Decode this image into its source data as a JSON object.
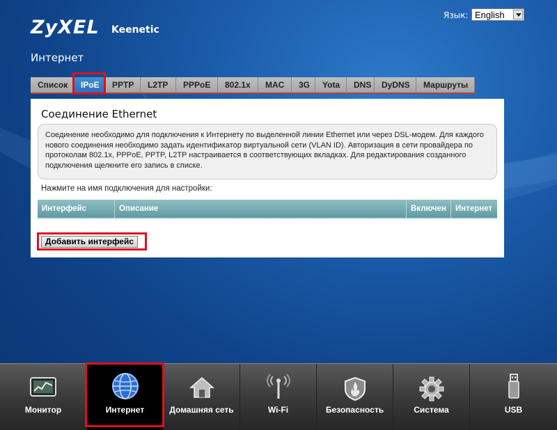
{
  "header": {
    "logo": "ZyXEL",
    "model": "Keenetic",
    "page_title": "Интернет",
    "language_label": "Язык:",
    "language_value": "English"
  },
  "tabs": [
    {
      "label": "Список",
      "active": false
    },
    {
      "label": "IPoE",
      "active": true
    },
    {
      "label": "PPTP",
      "active": false
    },
    {
      "label": "L2TP",
      "active": false
    },
    {
      "label": "PPPoE",
      "active": false
    },
    {
      "label": "802.1x",
      "active": false
    },
    {
      "label": "MAC",
      "active": false
    },
    {
      "label": "3G",
      "active": false
    },
    {
      "label": "Yota",
      "active": false
    },
    {
      "label": "DNS",
      "active": false
    },
    {
      "label": "DyDNS",
      "active": false
    },
    {
      "label": "Маршруты",
      "active": false
    }
  ],
  "panel": {
    "title": "Соединение Ethernet",
    "info_text": "Соединение необходимо для подключения к Интернету по выделенной линии Ethernet или через DSL-модем. Для каждого нового соединения необходимо задать идентификатор виртуальной сети (VLAN ID). Авторизация в сети провайдера по протоколам 802.1x, PPPoE, PPTP, L2TP настраивается в соответствующих вкладках. Для редактирования созданного подключения щелкните его запись в списке.",
    "hint": "Нажмите на имя подключения для настройки:",
    "table_headers": [
      "Интерфейс",
      "Описание",
      "Включен",
      "Интернет"
    ],
    "add_button": "Добавить интерфейс"
  },
  "bottom_nav": [
    {
      "label": "Монитор",
      "icon": "monitor-icon"
    },
    {
      "label": "Интернет",
      "icon": "globe-icon",
      "active": true
    },
    {
      "label": "Домашняя сеть",
      "icon": "home-icon"
    },
    {
      "label": "Wi-Fi",
      "icon": "wifi-antenna-icon"
    },
    {
      "label": "Безопасность",
      "icon": "shield-icon"
    },
    {
      "label": "Система",
      "icon": "gear-icon"
    },
    {
      "label": "USB",
      "icon": "usb-icon"
    }
  ]
}
